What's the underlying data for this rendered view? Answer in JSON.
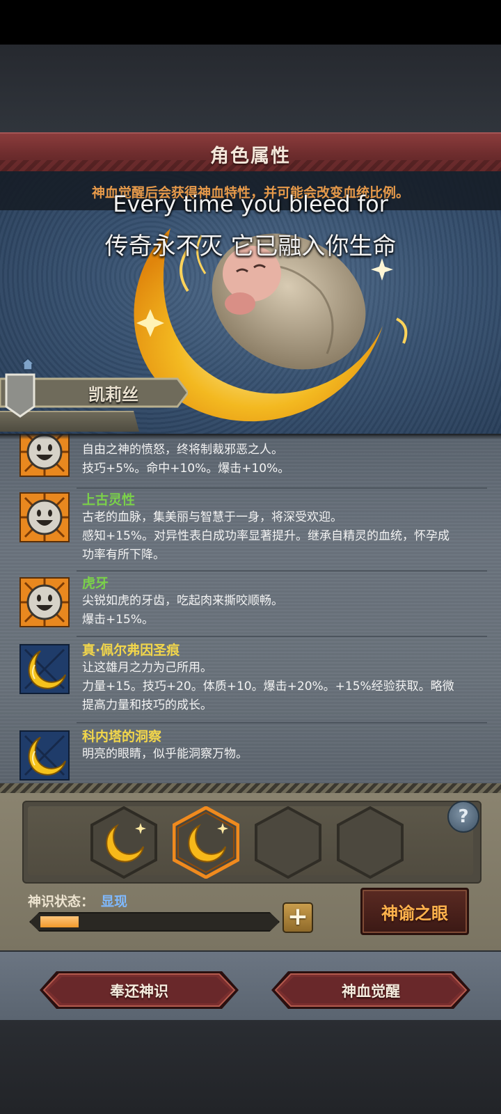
{
  "header": {
    "title": "角色属性"
  },
  "hero": {
    "notice": "神血觉醒后会获得神血特性，并可能会改变血统比例。",
    "subtitle_en": "Every time you bleed for",
    "subtitle_zh": "传奇永不灭 它已融入你生命",
    "character_name": "凯莉丝"
  },
  "traits": [
    {
      "icon": "smiley-sun-icon",
      "name": "",
      "lines": [
        "自由之神的愤怒，终将制裁邪恶之人。",
        "技巧+5%。命中+10%。爆击+10%。"
      ]
    },
    {
      "icon": "smiley-sun-icon",
      "name": "上古灵性",
      "name_color": "#7bd14a",
      "lines": [
        "古老的血脉，集美丽与智慧于一身，将深受欢迎。",
        "感知+15%。对异性表白成功率显著提升。继承自精灵的血统，怀孕成",
        "功率有所下降。"
      ]
    },
    {
      "icon": "smiley-sun-icon",
      "name": "虎牙",
      "name_color": "#7bd14a",
      "lines": [
        "尖锐如虎的牙齿，吃起肉来撕咬顺畅。",
        "爆击+15%。"
      ]
    },
    {
      "icon": "crescent-moon-icon",
      "name": "真·佩尔弗因圣痕",
      "name_color": "#f2d64b",
      "lines": [
        "让这雄月之力为己所用。",
        "力量+15。技巧+20。体质+10。爆击+20%。+15%经验获取。略微",
        "提高力量和技巧的成长。"
      ]
    },
    {
      "icon": "crescent-moon-icon",
      "name": "科内塔的洞察",
      "name_color": "#f2d64b",
      "lines": [
        "明亮的眼睛，似乎能洞察万物。"
      ]
    }
  ],
  "deity_panel": {
    "status_label": "神识状态：",
    "status_value": "显现",
    "progress": 0.17,
    "help_label": "?",
    "plus_label": "+",
    "eye_button": "神谕之眼"
  },
  "footer": {
    "return_button": "奉还神识",
    "awaken_button": "神血觉醒"
  },
  "colors": {
    "header_red": "#6d2c2d",
    "notice_orange": "#e79a4a",
    "green_trait": "#7bd14a",
    "gold_trait": "#f2d64b",
    "status_blue": "#7fb9ff",
    "progress_orange": "#f19a2c"
  }
}
